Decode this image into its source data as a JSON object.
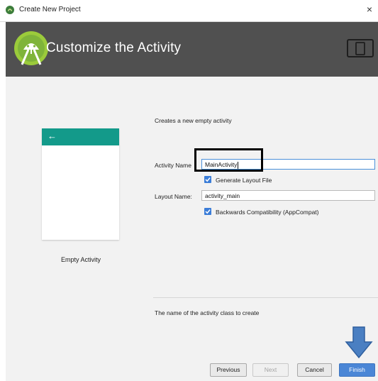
{
  "window": {
    "title": "Create New Project",
    "close_glyph": "×"
  },
  "banner": {
    "title": "Customize the Activity"
  },
  "preview": {
    "back_glyph": "←",
    "template_name": "Empty Activity"
  },
  "form": {
    "description": "Creates a new empty activity",
    "activity_name_label": "Activity Name",
    "activity_name_value": "MainActivity",
    "generate_layout_label": "Generate Layout File",
    "generate_layout_checked": true,
    "layout_name_label": "Layout Name:",
    "layout_name_value": "activity_main",
    "backwards_compat_label": "Backwards Compatibility (AppCompat)",
    "backwards_compat_checked": true,
    "hint": "The name of the activity class to create"
  },
  "buttons": {
    "previous": "Previous",
    "next": "Next",
    "cancel": "Cancel",
    "finish": "Finish"
  },
  "colors": {
    "banner_bg": "#505050",
    "android_green": "#9bcb3b",
    "preview_bar": "#139a8a",
    "primary_button": "#4a86d6",
    "checkbox": "#3b7dd8",
    "annotation_arrow": "#4a7fc2"
  },
  "icons": {
    "app": "android-studio-icon",
    "logo": "android-studio-logo-icon",
    "device": "device-form-factor-icon",
    "annotation": "down-arrow-annotation-icon"
  }
}
